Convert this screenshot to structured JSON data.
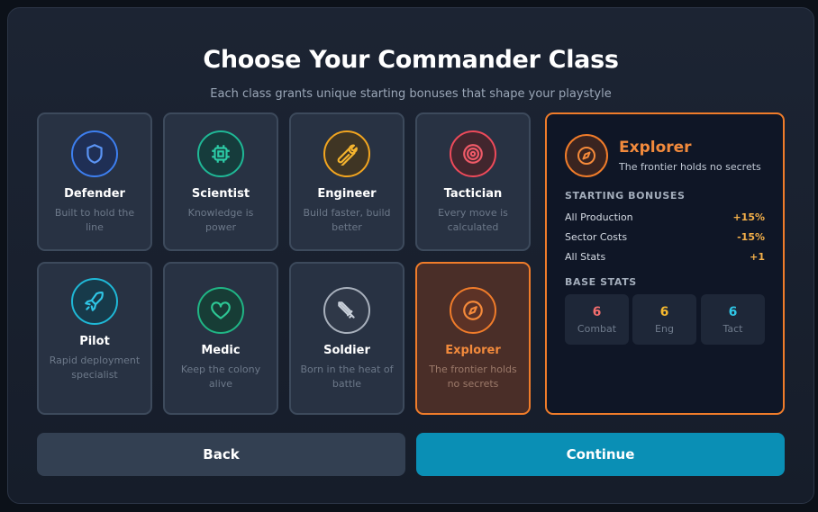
{
  "header": {
    "title": "Choose Your Commander Class",
    "subtitle": "Each class grants unique starting bonuses that shape your playstyle"
  },
  "classes": [
    {
      "name": "Defender",
      "desc": "Built to hold the line",
      "icon": "shield-icon",
      "color": "#3d7ff0"
    },
    {
      "name": "Scientist",
      "desc": "Knowledge is power",
      "icon": "chip-icon",
      "color": "#1fb896"
    },
    {
      "name": "Engineer",
      "desc": "Build faster, build better",
      "icon": "wrench-icon",
      "color": "#f2a51f"
    },
    {
      "name": "Tactician",
      "desc": "Every move is calculated",
      "icon": "target-icon",
      "color": "#ee4a5a"
    },
    {
      "name": "Pilot",
      "desc": "Rapid deployment specialist",
      "icon": "rocket-icon",
      "color": "#1fb8d6"
    },
    {
      "name": "Medic",
      "desc": "Keep the colony alive",
      "icon": "heart-icon",
      "color": "#20b585"
    },
    {
      "name": "Soldier",
      "desc": "Born in the heat of battle",
      "icon": "sword-icon",
      "color": "#b8c0cc"
    },
    {
      "name": "Explorer",
      "desc": "The frontier holds no secrets",
      "icon": "compass-icon",
      "color": "#f07c2a",
      "selected": true
    }
  ],
  "detail": {
    "name": "Explorer",
    "desc": "The frontier holds no secrets",
    "icon": "compass-icon",
    "bonuses_label": "STARTING BONUSES",
    "bonuses": [
      {
        "label": "All Production",
        "value": "+15%"
      },
      {
        "label": "Sector Costs",
        "value": "-15%"
      },
      {
        "label": "All Stats",
        "value": "+1"
      }
    ],
    "stats_label": "BASE STATS",
    "stats": [
      {
        "value": "6",
        "label": "Combat",
        "color": "#f26d6d"
      },
      {
        "value": "6",
        "label": "Eng",
        "color": "#f5b82e"
      },
      {
        "value": "6",
        "label": "Tact",
        "color": "#2fc6e6"
      }
    ]
  },
  "buttons": {
    "back": "Back",
    "continue": "Continue"
  }
}
